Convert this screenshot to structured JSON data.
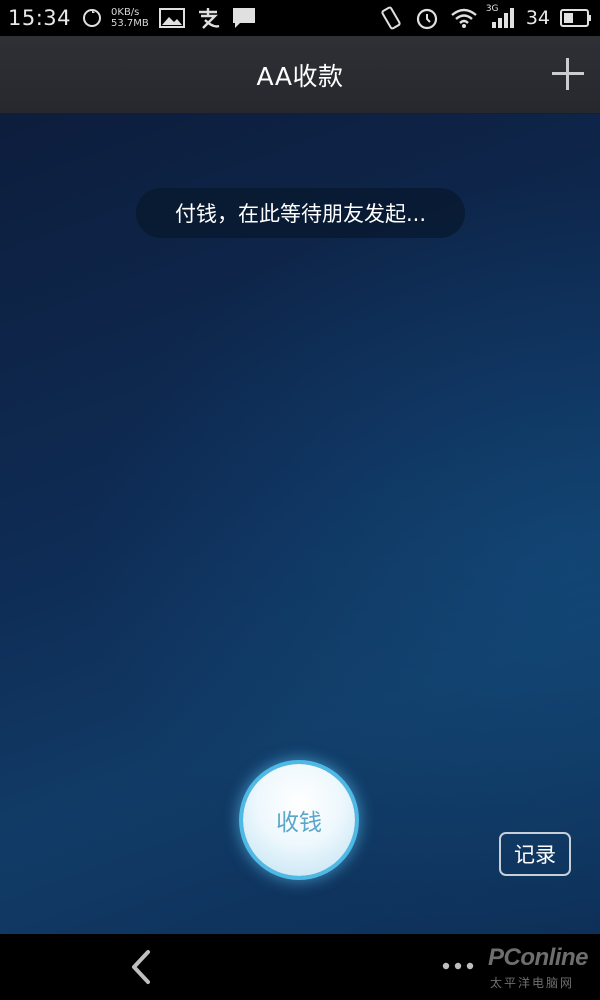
{
  "status_bar": {
    "time": "15:34",
    "net_speed_up": "0KB/s",
    "net_speed_down": "53.7MB",
    "network_type": "3G",
    "battery_level": "34",
    "icons": [
      "sync-icon",
      "android-icon",
      "image-icon",
      "alipay-icon",
      "message-icon",
      "vibrate-icon",
      "alarm-icon",
      "wifi-icon",
      "signal-icon",
      "battery-icon"
    ]
  },
  "header": {
    "title": "AA收款",
    "add_icon": "plus-icon"
  },
  "main": {
    "bubble_text": "付钱，在此等待朋友发起...",
    "collect_button_label": "收钱",
    "record_button_label": "记录"
  },
  "nav_bar": {
    "back_icon": "back-arrow-icon",
    "menu_icon": "more-dots-icon"
  },
  "watermark": {
    "brand": "PConline",
    "subtitle": "太平洋电脑网"
  },
  "colors": {
    "accent_ring": "#4fb9e6",
    "button_text": "#5ba6c9",
    "background": "#0e2c55"
  }
}
